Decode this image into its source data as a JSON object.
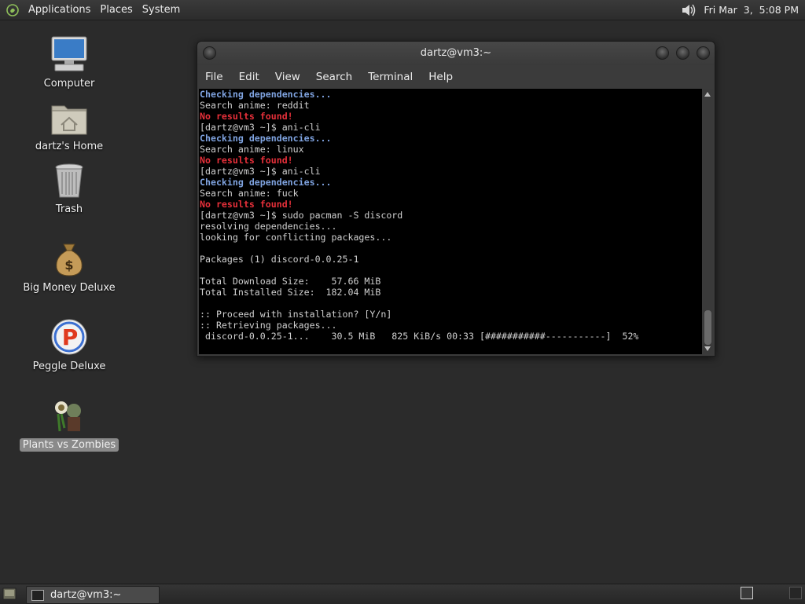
{
  "top_panel": {
    "menus": [
      "Applications",
      "Places",
      "System"
    ],
    "clock": "Fri Mar  3,  5:08 PM",
    "icons": {
      "logo": "gnome-foot-icon",
      "volume": "speaker-icon"
    }
  },
  "desktop_icons": [
    {
      "label": "Computer",
      "icon": "computer-icon"
    },
    {
      "label": "dartz's Home",
      "icon": "home-folder-icon"
    },
    {
      "label": "Trash",
      "icon": "trash-icon"
    },
    {
      "label": "Big Money Deluxe",
      "icon": "money-bag-icon"
    },
    {
      "label": "Peggle Deluxe",
      "icon": "peggle-icon"
    },
    {
      "label": "Plants vs Zombies",
      "icon": "plants-vs-zombies-icon",
      "selected": true
    }
  ],
  "terminal": {
    "title": "dartz@vm3:~",
    "menu": [
      "File",
      "Edit",
      "View",
      "Search",
      "Terminal",
      "Help"
    ],
    "lines": [
      {
        "text": "Checking dependencies...",
        "style": "blue"
      },
      {
        "text": "Search anime: reddit",
        "style": "normal"
      },
      {
        "text": "No results found!",
        "style": "red"
      },
      {
        "text": "[dartz@vm3 ~]$ ani-cli",
        "style": "normal"
      },
      {
        "text": "Checking dependencies...",
        "style": "blue"
      },
      {
        "text": "Search anime: linux",
        "style": "normal"
      },
      {
        "text": "No results found!",
        "style": "red"
      },
      {
        "text": "[dartz@vm3 ~]$ ani-cli",
        "style": "normal"
      },
      {
        "text": "Checking dependencies...",
        "style": "blue"
      },
      {
        "text": "Search anime: fuck",
        "style": "normal"
      },
      {
        "text": "No results found!",
        "style": "red"
      },
      {
        "text": "[dartz@vm3 ~]$ sudo pacman -S discord",
        "style": "normal"
      },
      {
        "text": "resolving dependencies...",
        "style": "normal"
      },
      {
        "text": "looking for conflicting packages...",
        "style": "normal"
      },
      {
        "text": "",
        "style": "normal"
      },
      {
        "text": "Packages (1) discord-0.0.25-1",
        "style": "normal"
      },
      {
        "text": "",
        "style": "normal"
      },
      {
        "text": "Total Download Size:    57.66 MiB",
        "style": "normal"
      },
      {
        "text": "Total Installed Size:  182.04 MiB",
        "style": "normal"
      },
      {
        "text": "",
        "style": "normal"
      },
      {
        "text": ":: Proceed with installation? [Y/n]",
        "style": "normal"
      },
      {
        "text": ":: Retrieving packages...",
        "style": "normal"
      },
      {
        "text": " discord-0.0.25-1...    30.5 MiB   825 KiB/s 00:33 [###########-----------]  52%",
        "style": "normal"
      }
    ]
  },
  "taskbar": {
    "window_button": "dartz@vm3:~"
  }
}
